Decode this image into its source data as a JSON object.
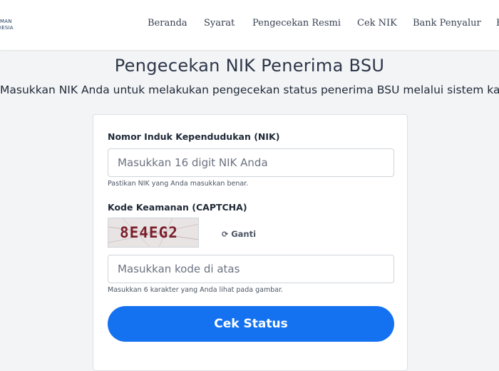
{
  "logo": {
    "line1": "MAN",
    "line2": "IESIA"
  },
  "nav": {
    "items": [
      {
        "label": "Beranda"
      },
      {
        "label": "Syarat"
      },
      {
        "label": "Pengecekan Resmi"
      },
      {
        "label": "Cek NIK"
      },
      {
        "label": "Bank Penyalur"
      },
      {
        "label": "F"
      }
    ]
  },
  "page": {
    "title": "Pengecekan NIK Penerima BSU",
    "subtitle": "Masukkan NIK Anda untuk melakukan pengecekan status penerima BSU melalui sistem kami."
  },
  "form": {
    "nik": {
      "label": "Nomor Induk Kependudukan (NIK)",
      "placeholder": "Masukkan 16 digit NIK Anda",
      "value": "",
      "help": "Pastikan NIK yang Anda masukkan benar."
    },
    "captcha": {
      "label": "Kode Keamanan (CAPTCHA)",
      "code": "8E4EG2",
      "refresh_icon": "refresh-icon",
      "refresh_label": "Ganti",
      "placeholder": "Masukkan kode di atas",
      "value": "",
      "help": "Masukkan 6 karakter yang Anda lihat pada gambar."
    },
    "submit_label": "Cek Status"
  },
  "colors": {
    "accent": "#1472f0",
    "captcha_text": "#7a1f2b",
    "background": "#f3f4f6"
  }
}
